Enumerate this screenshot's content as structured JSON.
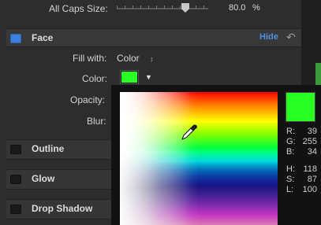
{
  "all_caps": {
    "label": "All Caps Size:",
    "value": "80.0",
    "unit": "%",
    "level_fraction": 0.8
  },
  "face": {
    "title": "Face",
    "hide_label": "Hide",
    "fill_label": "Fill with:",
    "fill_value": "Color",
    "color_label": "Color:",
    "opacity_label": "Opacity:",
    "blur_label": "Blur:"
  },
  "sections": [
    {
      "title": "Outline"
    },
    {
      "title": "Glow"
    },
    {
      "title": "Drop Shadow"
    }
  ],
  "picker": {
    "current_color": "#27FF22",
    "readouts": [
      {
        "label": "R:",
        "value": "39"
      },
      {
        "label": "G:",
        "value": "255"
      },
      {
        "label": "B:",
        "value": "34"
      },
      {
        "label": "H:",
        "value": "118"
      },
      {
        "label": "S:",
        "value": "87"
      },
      {
        "label": "L:",
        "value": "100"
      }
    ]
  },
  "icons": {
    "face_toggle": "checkbox-checked-icon",
    "reset": "reset-arrow-icon",
    "stepper": "updown-stepper-icon",
    "dropdown": "triangle-down-icon",
    "eyedropper": "eyedropper-icon"
  }
}
